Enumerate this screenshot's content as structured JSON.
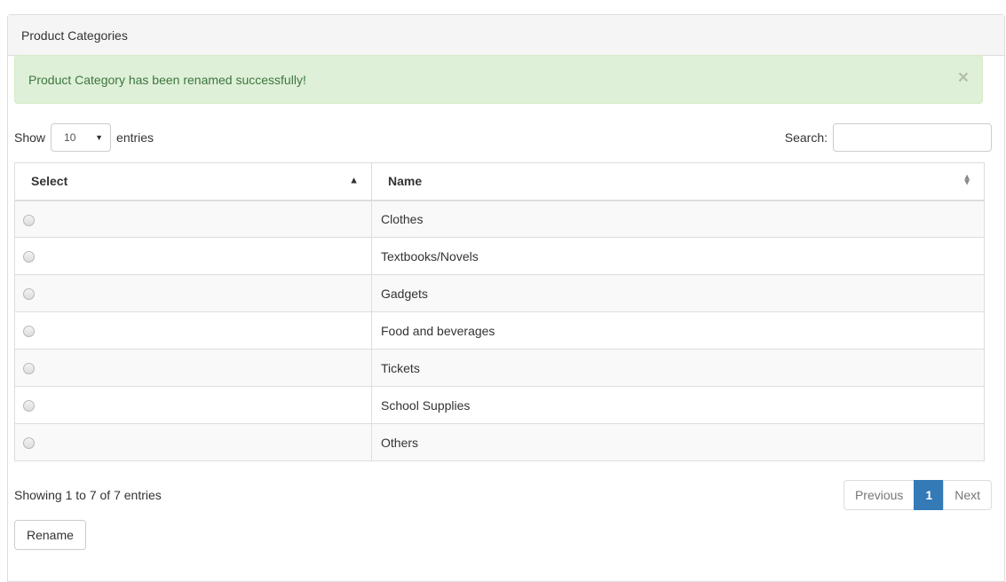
{
  "panel": {
    "title": "Product Categories"
  },
  "alert": {
    "message": "Product Category has been renamed successfully!",
    "close_icon": "×"
  },
  "length": {
    "show_label": "Show",
    "selected": "10",
    "entries_label": "entries"
  },
  "search": {
    "label": "Search:",
    "value": "",
    "placeholder": ""
  },
  "table": {
    "headers": {
      "select": "Select",
      "name": "Name"
    },
    "sort": {
      "select": "ascending",
      "name": "none"
    },
    "rows": [
      {
        "name": "Clothes",
        "selected": false
      },
      {
        "name": "Textbooks/Novels",
        "selected": false
      },
      {
        "name": "Gadgets",
        "selected": false
      },
      {
        "name": "Food and beverages",
        "selected": false
      },
      {
        "name": "Tickets",
        "selected": false
      },
      {
        "name": "School Supplies",
        "selected": false
      },
      {
        "name": "Others",
        "selected": false
      }
    ]
  },
  "info": "Showing 1 to 7 of 7 entries",
  "pagination": {
    "previous": "Previous",
    "current": "1",
    "next": "Next"
  },
  "actions": {
    "rename_label": "Rename"
  },
  "colors": {
    "alert_bg": "#dff0d8",
    "alert_text": "#3c763d",
    "active_page": "#337ab7"
  }
}
